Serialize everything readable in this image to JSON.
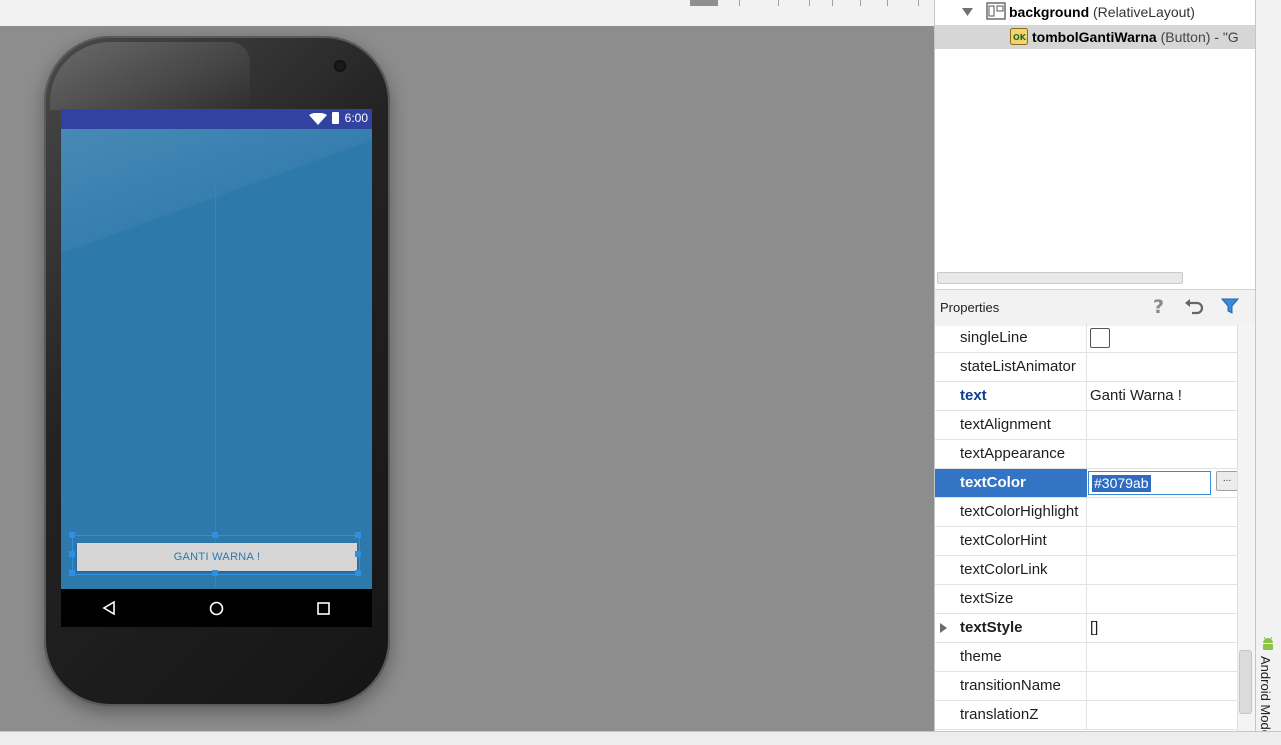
{
  "colors": {
    "accent_blue": "#3474c4",
    "app_background": "#2e79ab",
    "status_bar": "#3242a0",
    "guide_green": "#1ea34e",
    "selection_blue": "#2f8fe0"
  },
  "phone": {
    "status_time": "6:00",
    "status_icons": [
      "wifi-icon",
      "battery-icon"
    ],
    "button_text": "GANTI WARNA !",
    "nav_icons": [
      "back-icon",
      "home-icon",
      "recents-icon"
    ]
  },
  "component_tree": {
    "rows": [
      {
        "name": "background",
        "type": " (RelativeLayout)",
        "icon": "relativelayout-icon",
        "expanded": true
      },
      {
        "name": "tombolGantiWarna",
        "type": " (Button) - \"G",
        "icon": "button-icon",
        "selected": true
      }
    ]
  },
  "properties": {
    "title": "Properties",
    "header_icons": [
      "help-icon",
      "undo-icon",
      "filter-icon"
    ],
    "rows": [
      {
        "name": "singleLine",
        "value": ""
      },
      {
        "name": "stateListAnimator",
        "value": ""
      },
      {
        "name": "text",
        "value": "Ganti Warna !"
      },
      {
        "name": "textAlignment",
        "value": ""
      },
      {
        "name": "textAppearance",
        "value": ""
      },
      {
        "name": "textColor",
        "value": "#3079ab"
      },
      {
        "name": "textColorHighlight",
        "value": ""
      },
      {
        "name": "textColorHint",
        "value": ""
      },
      {
        "name": "textColorLink",
        "value": ""
      },
      {
        "name": "textSize",
        "value": ""
      },
      {
        "name": "textStyle",
        "value": "[]"
      },
      {
        "name": "theme",
        "value": ""
      },
      {
        "name": "transitionName",
        "value": ""
      },
      {
        "name": "translationZ",
        "value": ""
      }
    ],
    "ellipsis_label": "..."
  },
  "side_tab": {
    "label": "Android Mode"
  }
}
